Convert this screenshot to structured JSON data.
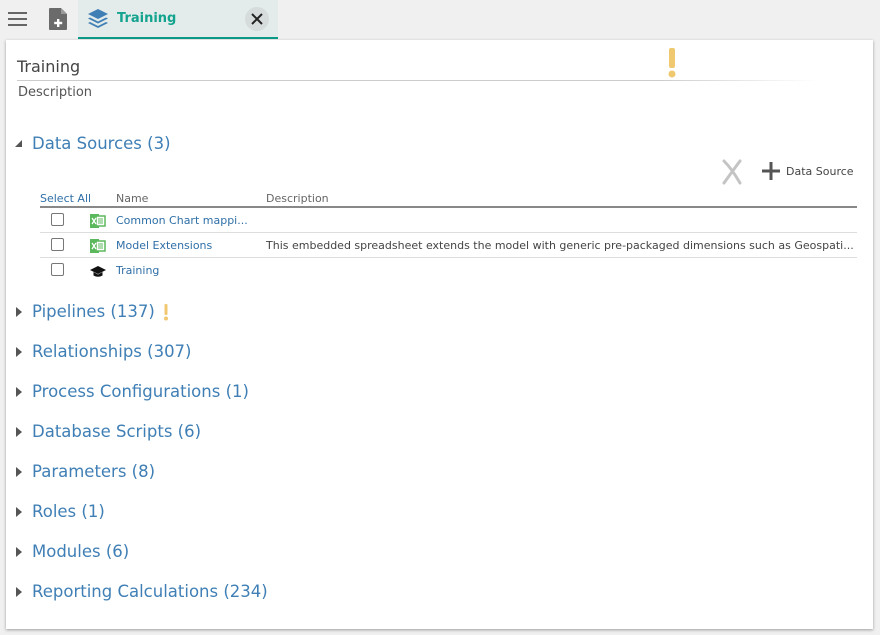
{
  "topbar": {
    "menu_icon": "hamburger-icon",
    "new_icon": "new-document-icon",
    "tab": {
      "label": "Training",
      "icon": "layers-icon",
      "close_icon": "close-icon",
      "accent": "#13a38e"
    }
  },
  "form": {
    "title_value": "Training",
    "description_placeholder": "Description",
    "warning_icon": "exclamation-icon",
    "warning_color": "#f0c870"
  },
  "data_sources": {
    "label": "Data Sources (3)",
    "expanded": true,
    "toolbar": {
      "remove_icon": "remove-icon",
      "add_label": "Data Source",
      "add_icon": "plus-icon"
    },
    "columns": {
      "select_all": "Select All",
      "name": "Name",
      "description": "Description"
    },
    "rows": [
      {
        "icon": "excel-icon",
        "name": "Common Chart mappi...",
        "description": "",
        "checked": false
      },
      {
        "icon": "excel-icon",
        "name": "Model Extensions",
        "description": "This embedded spreadsheet extends the model with generic pre-packaged dimensions such as Geospati...",
        "checked": false
      },
      {
        "icon": "graduation-cap-icon",
        "name": "Training",
        "description": "",
        "checked": false
      }
    ]
  },
  "sections": [
    {
      "label": "Pipelines (137)",
      "warning": true
    },
    {
      "label": "Relationships (307)",
      "warning": false
    },
    {
      "label": "Process Configurations (1)",
      "warning": false
    },
    {
      "label": "Database Scripts (6)",
      "warning": false
    },
    {
      "label": "Parameters (8)",
      "warning": false
    },
    {
      "label": "Roles (1)",
      "warning": false
    },
    {
      "label": "Modules (6)",
      "warning": false
    },
    {
      "label": "Reporting Calculations (234)",
      "warning": false
    }
  ]
}
